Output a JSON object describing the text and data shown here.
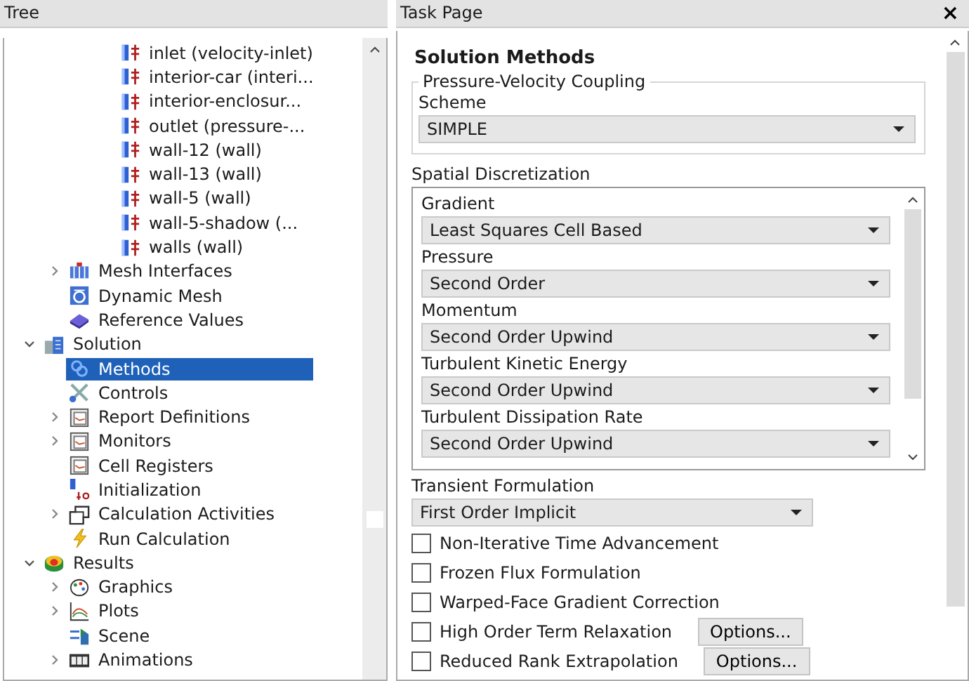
{
  "tree": {
    "title": "Tree",
    "zones": [
      {
        "label": "inlet (velocity-inlet)",
        "kind": "zone"
      },
      {
        "label": "interior-car (interi...",
        "kind": "zone"
      },
      {
        "label": "interior-enclosur...",
        "kind": "zone"
      },
      {
        "label": "outlet (pressure-...",
        "kind": "zone"
      },
      {
        "label": "wall-12 (wall)",
        "kind": "zone"
      },
      {
        "label": "wall-13 (wall)",
        "kind": "zone"
      },
      {
        "label": "wall-5 (wall)",
        "kind": "zone"
      },
      {
        "label": "wall-5-shadow (...",
        "kind": "zone"
      },
      {
        "label": "walls (wall)",
        "kind": "zone"
      }
    ],
    "setup_items": [
      {
        "label": "Mesh Interfaces",
        "kind": "interfaces",
        "expanded": false,
        "selected": false
      },
      {
        "label": "Dynamic Mesh",
        "kind": "dynamic",
        "selected": false
      },
      {
        "label": "Reference Values",
        "kind": "reference",
        "selected": false
      }
    ],
    "items": [
      {
        "label": "Solution",
        "kind": "solution",
        "expanded": true,
        "selected": false,
        "children": [
          {
            "label": "Methods",
            "kind": "methods",
            "selected": true
          },
          {
            "label": "Controls",
            "kind": "controls",
            "selected": false
          },
          {
            "label": "Report Definitions",
            "kind": "report",
            "expanded": false,
            "selected": false
          },
          {
            "label": "Monitors",
            "kind": "report",
            "expanded": false,
            "selected": false
          },
          {
            "label": "Cell Registers",
            "kind": "report",
            "selected": false
          },
          {
            "label": "Initialization",
            "kind": "init",
            "selected": false
          },
          {
            "label": "Calculation Activities",
            "kind": "activities",
            "expanded": false,
            "selected": false
          },
          {
            "label": "Run Calculation",
            "kind": "run",
            "selected": false
          }
        ]
      },
      {
        "label": "Results",
        "kind": "results",
        "expanded": true,
        "selected": false,
        "children": [
          {
            "label": "Graphics",
            "kind": "graphics",
            "expanded": false,
            "selected": false
          },
          {
            "label": "Plots",
            "kind": "plots",
            "expanded": false,
            "selected": false
          },
          {
            "label": "Scene",
            "kind": "scene",
            "selected": false
          },
          {
            "label": "Animations",
            "kind": "animations",
            "expanded": false,
            "selected": false
          }
        ]
      }
    ]
  },
  "task_page": {
    "title": "Task Page",
    "close": "×",
    "heading": "Solution Methods",
    "coupling": {
      "title": "Pressure-Velocity Coupling",
      "label": "Scheme",
      "value": "SIMPLE"
    },
    "spatial": {
      "title": "Spatial Discretization",
      "fields": [
        {
          "label": "Gradient",
          "value": "Least Squares Cell Based"
        },
        {
          "label": "Pressure",
          "value": "Second Order"
        },
        {
          "label": "Momentum",
          "value": "Second Order Upwind"
        },
        {
          "label": "Turbulent Kinetic Energy",
          "value": "Second Order Upwind"
        },
        {
          "label": "Turbulent Dissipation Rate",
          "value": "Second Order Upwind"
        }
      ]
    },
    "transient": {
      "label": "Transient Formulation",
      "value": "First Order Implicit"
    },
    "options": [
      {
        "label": "Non-Iterative Time Advancement",
        "checked": false
      },
      {
        "label": "Frozen Flux Formulation",
        "checked": false
      },
      {
        "label": "Warped-Face Gradient Correction",
        "checked": false
      },
      {
        "label": "High Order Term Relaxation",
        "checked": false,
        "button": "Options..."
      },
      {
        "label": "Reduced Rank Extrapolation",
        "checked": false,
        "button": "Options..."
      }
    ]
  }
}
